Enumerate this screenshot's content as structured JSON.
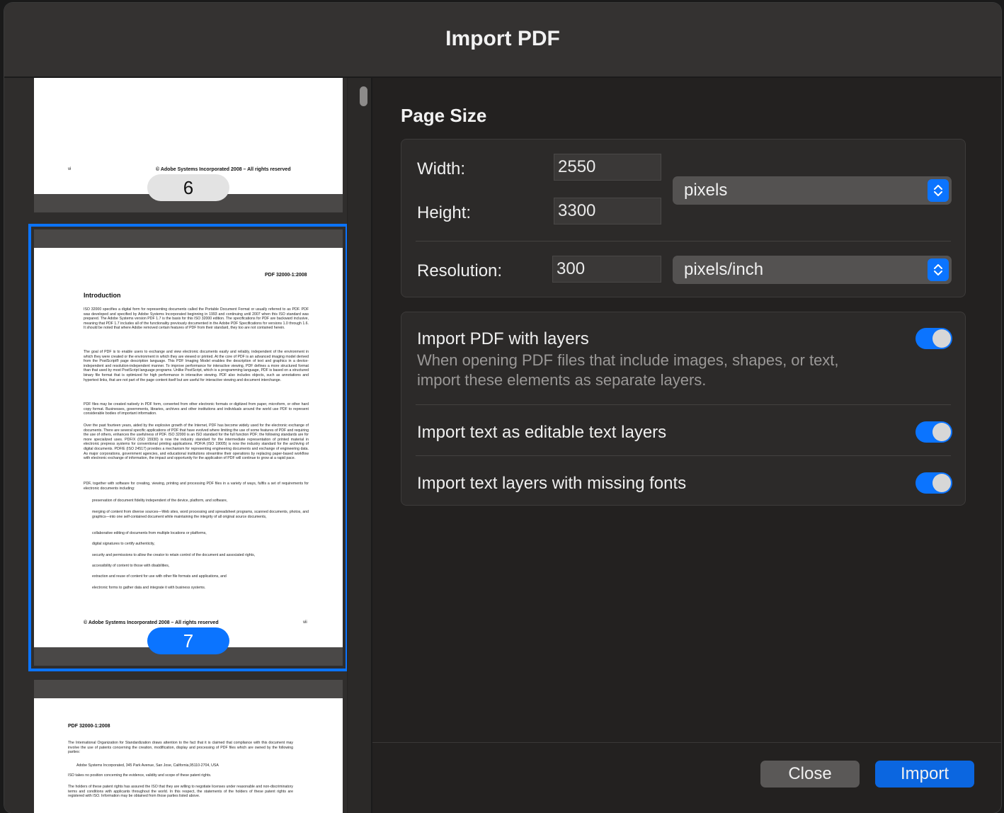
{
  "dialog": {
    "title": "Import PDF"
  },
  "sidebar": {
    "pages": [
      {
        "number": "6",
        "footer_left": "vi",
        "footer_center": "© Adobe Systems Incorporated 2008 – All rights reserved"
      },
      {
        "number": "7",
        "header": "PDF 32000-1:2008",
        "heading": "Introduction",
        "paragraphs": [
          "ISO 32000 specifies a digital form for representing documents called the Portable Document Format or usually referred to as PDF. PDF was developed and specified by Adobe Systems Incorporated beginning in 1993 and continuing until 2007 when this ISO standard was prepared. The Adobe Systems version PDF 1.7 is the basis for this ISO 32000 edition. The specifications for PDF are backward inclusive, meaning that PDF 1.7 includes all of the functionality previously documented in the Adobe PDF Specifications for versions 1.0 through 1.6. It should be noted that where Adobe removed certain features of PDF from their standard, they too are not contained herein.",
          "The goal of PDF is to enable users to exchange and view electronic documents easily and reliably, independent of the environment in which they were created or the environment in which they are viewed or printed. At the core of PDF is an advanced imaging model derived from the PostScript® page description language. This PDF Imaging Model enables the description of text and graphics in a device-independent and resolution-independent manner. To improve performance for interactive viewing, PDF defines a more structured format than that used by most PostScript language programs. Unlike PostScript, which is a programming language, PDF is based on a structured binary file format that is optimized for high performance in interactive viewing. PDF also includes objects, such as annotations and hypertext links, that are not part of the page content itself but are useful for interactive viewing and document interchange.",
          "PDF files may be created natively in PDF form, converted from other electronic formats or digitized from paper, microform, or other hard copy format. Businesses, governments, libraries, archives and other institutions and individuals around the world use PDF to represent considerable bodies of important information.",
          "Over the past fourteen years, aided by the explosive growth of the Internet, PDF has become widely used for the electronic exchange of documents. There are several specific applications of PDF that have evolved where limiting the use of some features of PDF and requiring the use of others, enhances the usefulness of PDF. ISO 32000 is an ISO standard for the full function PDF; the following standards are for more specialized uses. PDF/X (ISO 15930) is now the industry standard for the intermediate representation of printed material in electronic prepress systems for conventional printing applications. PDF/A (ISO 19005) is now the industry standard for the archiving of digital documents. PDF/E (ISO 24517) provides a mechanism for representing engineering documents and exchange of engineering data. As major corporations, government agencies, and educational institutions streamline their operations by replacing paper-based workflow with electronic exchange of information, the impact and opportunity for the application of PDF will continue to grow at a rapid pace.",
          "PDF, together with software for creating, viewing, printing and processing PDF files in a variety of ways, fulfils a set of requirements for electronic documents including:"
        ],
        "bullets": [
          "preservation of document fidelity independent of the device, platform, and software,",
          "merging of content from diverse sources—Web sites, word processing and spreadsheet programs, scanned documents, photos, and graphics—into one self-contained document while maintaining the integrity of all original source documents,",
          "collaborative editing of documents from multiple locations or platforms,",
          "digital signatures to certify authenticity,",
          "security and permissions to allow the creator to retain control of the document and associated rights,",
          "accessibility of content to those with disabilities,",
          "extraction and reuse of content for use with other file formats and applications, and",
          "electronic forms to gather data and integrate it with business systems."
        ],
        "footer_left": "© Adobe Systems Incorporated 2008 – All rights reserved",
        "footer_right": "vii"
      },
      {
        "header": "PDF 32000-1:2008",
        "paragraphs": [
          "The International Organization for Standardization draws attention to the fact that it is claimed that compliance with this document may involve the use of patents concerning the creation, modification, display and processing of PDF files which are owned by the following parties:",
          "ISO takes no position concerning the evidence, validity and scope of these patent rights.",
          "The holders of these patent rights has assured the ISO that they are willing to negotiate licenses under reasonable and non-discriminatory terms and conditions with applicants throughout the world. In this respect, the statements of the holders of these patent rights are registered with ISO. Information may be obtained from those parties listed above."
        ],
        "bullet": "Adobe Systems Incorporated, 345 Park Avenue, San Jose, California,95110-2704, USA"
      }
    ]
  },
  "page_size": {
    "heading": "Page Size",
    "width_label": "Width:",
    "width_value": "2550",
    "height_label": "Height:",
    "height_value": "3300",
    "unit": "pixels",
    "resolution_label": "Resolution:",
    "resolution_value": "300",
    "resolution_unit": "pixels/inch"
  },
  "options": [
    {
      "title": "Import PDF with layers",
      "description": "When opening PDF files that include images, shapes, or text, import these elements as separate layers.",
      "on": true
    },
    {
      "title": "Import text as editable text layers",
      "on": true
    },
    {
      "title": "Import text layers with missing fonts",
      "on": true
    }
  ],
  "buttons": {
    "close": "Close",
    "import": "Import"
  },
  "colors": {
    "accent": "#0b74ff",
    "background": "#232120",
    "titlebar": "#343231"
  }
}
